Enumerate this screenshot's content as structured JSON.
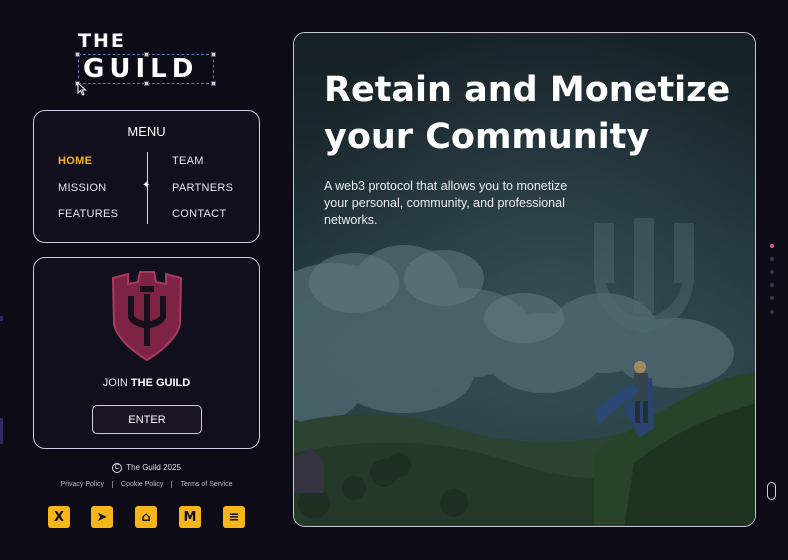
{
  "brand": {
    "line1": "THE",
    "line2": "GUILD"
  },
  "menu": {
    "title": "MENU",
    "left": [
      {
        "label": "HOME",
        "active": true
      },
      {
        "label": "MISSION",
        "active": false
      },
      {
        "label": "FEATURES",
        "active": false
      }
    ],
    "right": [
      {
        "label": "TEAM"
      },
      {
        "label": "PARTNERS"
      },
      {
        "label": "CONTACT"
      }
    ]
  },
  "join": {
    "prefix": "JOIN ",
    "bold": "THE GUILD",
    "button": "ENTER"
  },
  "footer": {
    "copyright": "The Guild 2025",
    "links": [
      "Privacy Policy",
      "Cookie Policy",
      "Terms of Service"
    ]
  },
  "socials": [
    {
      "icon": "x-icon",
      "glyph": "X"
    },
    {
      "icon": "telegram-icon",
      "glyph": "➤"
    },
    {
      "icon": "github-icon",
      "glyph": "⌂"
    },
    {
      "icon": "medium-icon",
      "glyph": "M"
    },
    {
      "icon": "gitbook-icon",
      "glyph": "≡"
    }
  ],
  "hero": {
    "title": "Retain and Monetize your Community",
    "subtitle": "A web3 protocol that allows you to monetize your personal, community, and professional networks."
  },
  "colors": {
    "accent": "#f5b51b",
    "active_dot": "#e0566e",
    "background": "#0d0b15"
  },
  "section_dots": {
    "count": 6,
    "active_index": 0
  }
}
